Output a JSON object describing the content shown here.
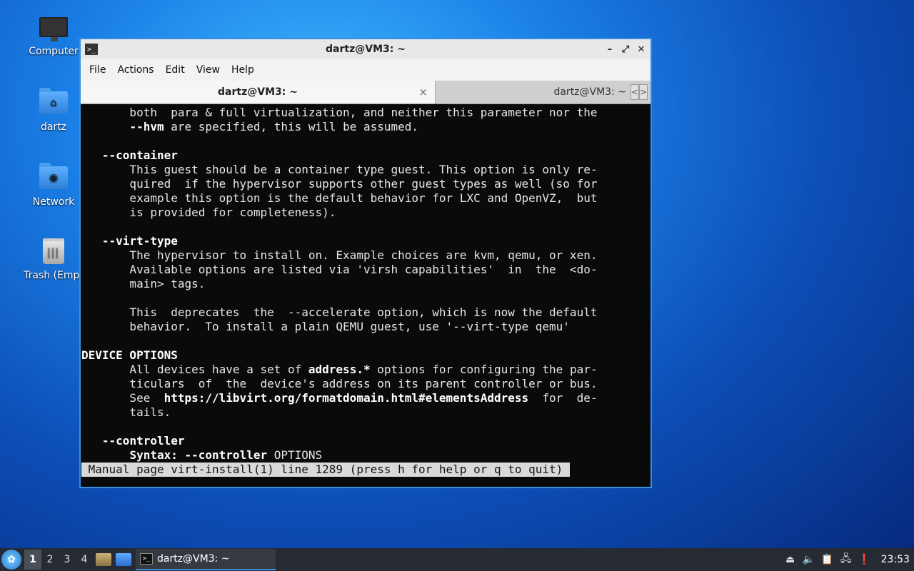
{
  "desktop": {
    "icons": [
      {
        "label": "Computer"
      },
      {
        "label": "dartz"
      },
      {
        "label": "Network"
      },
      {
        "label": "Trash (Empt"
      }
    ]
  },
  "window": {
    "title": "dartz@VM3: ~",
    "controls": {
      "minimize": "–",
      "maximize": "⤢",
      "close": "✕"
    },
    "menu": [
      "File",
      "Actions",
      "Edit",
      "View",
      "Help"
    ],
    "tabs": [
      {
        "label": "dartz@VM3: ~",
        "active": true,
        "close": "×"
      },
      {
        "label": "dartz@VM3: ~",
        "active": false
      }
    ],
    "tab_scroll": {
      "left": "<",
      "right": ">"
    }
  },
  "terminal": {
    "lines": [
      [
        {
          "t": "       both  para & full virtualization, and neither this parameter nor the"
        }
      ],
      [
        {
          "t": "       "
        },
        {
          "t": "--hvm",
          "b": true
        },
        {
          "t": " are specified, this will be assumed."
        }
      ],
      [
        {
          "t": ""
        }
      ],
      [
        {
          "t": "   "
        },
        {
          "t": "--container",
          "b": true
        }
      ],
      [
        {
          "t": "       This guest should be a container type guest. This option is only re-"
        }
      ],
      [
        {
          "t": "       quired  if the hypervisor supports other guest types as well (so for"
        }
      ],
      [
        {
          "t": "       example this option is the default behavior for LXC and OpenVZ,  but"
        }
      ],
      [
        {
          "t": "       is provided for completeness)."
        }
      ],
      [
        {
          "t": ""
        }
      ],
      [
        {
          "t": "   "
        },
        {
          "t": "--virt-type",
          "b": true
        }
      ],
      [
        {
          "t": "       The hypervisor to install on. Example choices are kvm, qemu, or xen."
        }
      ],
      [
        {
          "t": "       Available options are listed via 'virsh capabilities'  in  the  <do-"
        }
      ],
      [
        {
          "t": "       main> tags."
        }
      ],
      [
        {
          "t": ""
        }
      ],
      [
        {
          "t": "       This  deprecates  the  --accelerate option, which is now the default"
        }
      ],
      [
        {
          "t": "       behavior.  To install a plain QEMU guest, use '--virt-type qemu'"
        }
      ],
      [
        {
          "t": ""
        }
      ],
      [
        {
          "t": "DEVICE OPTIONS",
          "b": true
        }
      ],
      [
        {
          "t": "       All devices have a set of "
        },
        {
          "t": "address.*",
          "b": true
        },
        {
          "t": " options for configuring the par-"
        }
      ],
      [
        {
          "t": "       ticulars  of  the  device's address on its parent controller or bus."
        }
      ],
      [
        {
          "t": "       See  "
        },
        {
          "t": "https://libvirt.org/formatdomain.html#elementsAddress",
          "b": true
        },
        {
          "t": "  for  de-"
        }
      ],
      [
        {
          "t": "       tails."
        }
      ],
      [
        {
          "t": ""
        }
      ],
      [
        {
          "t": "   "
        },
        {
          "t": "--controller",
          "b": true
        }
      ],
      [
        {
          "t": "       "
        },
        {
          "t": "Syntax: --controller",
          "b": true
        },
        {
          "t": " OPTIONS"
        }
      ]
    ],
    "status": " Manual page virt-install(1) line 1289 (press h for help or q to quit) "
  },
  "taskbar": {
    "workspaces": [
      "1",
      "2",
      "3",
      "4"
    ],
    "active_workspace": "1",
    "task_label": "dartz@VM3: ~",
    "clock": "23:53",
    "accent": "#3a8de0"
  }
}
